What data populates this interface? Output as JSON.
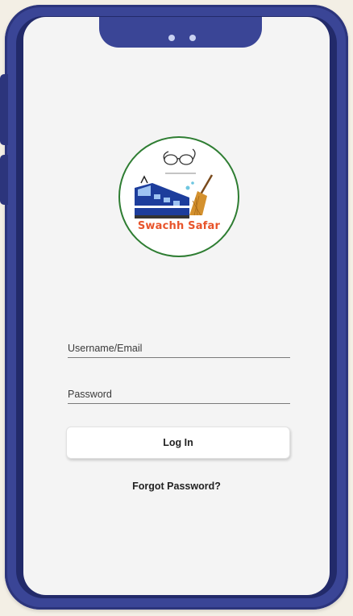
{
  "app": {
    "logo_text": "Swachh Safar",
    "brand_colors": {
      "accent_text": "#e8542b",
      "logo_ring": "#2e7d32",
      "frame": "#3a4596"
    }
  },
  "login_form": {
    "username_placeholder": "Username/Email",
    "password_placeholder": "Password",
    "login_label": "Log In",
    "forgot_password_label": "Forgot Password?"
  },
  "icons": {
    "logo": "swachh-bharat-glasses-train-broom-logo"
  }
}
